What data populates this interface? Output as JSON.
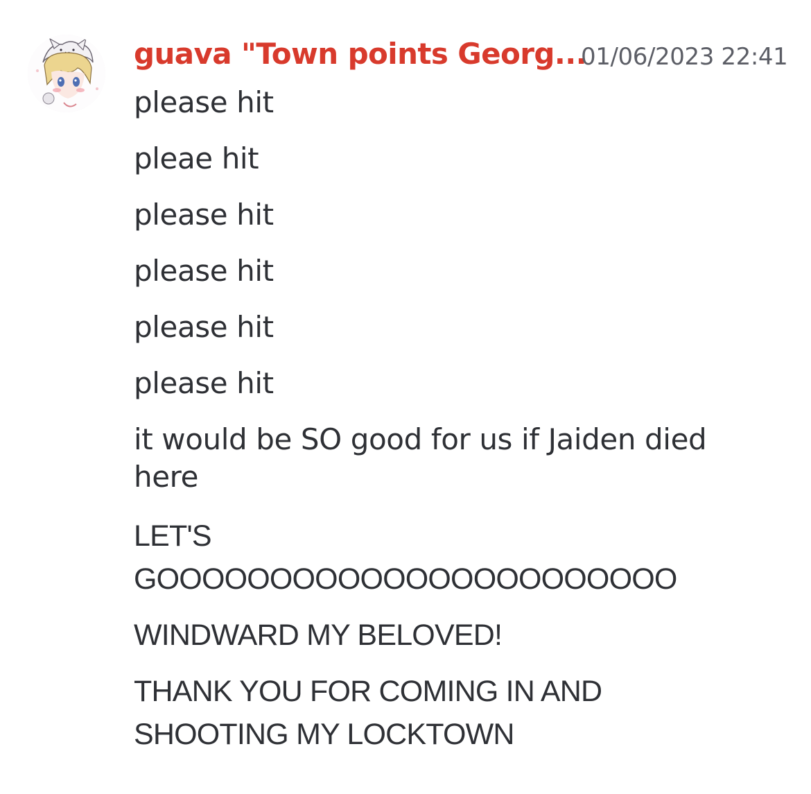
{
  "message": {
    "author": "guava \"Town points Georg...",
    "timestamp": "01/06/2023 22:41",
    "author_color": "#d83a2c",
    "avatar_icon": "anime-avatar-icon",
    "lines": [
      "please hit",
      "pleae hit",
      "please hit",
      "please hit",
      "please hit",
      "please hit",
      "it would be SO good for us if Jaiden died here",
      "LET'S GOOOOOOOOOOOOOOOOOOOOOOO",
      "WINDWARD MY BELOVED!",
      "THANK YOU FOR COMING IN AND SHOOTING MY LOCKTOWN"
    ]
  }
}
